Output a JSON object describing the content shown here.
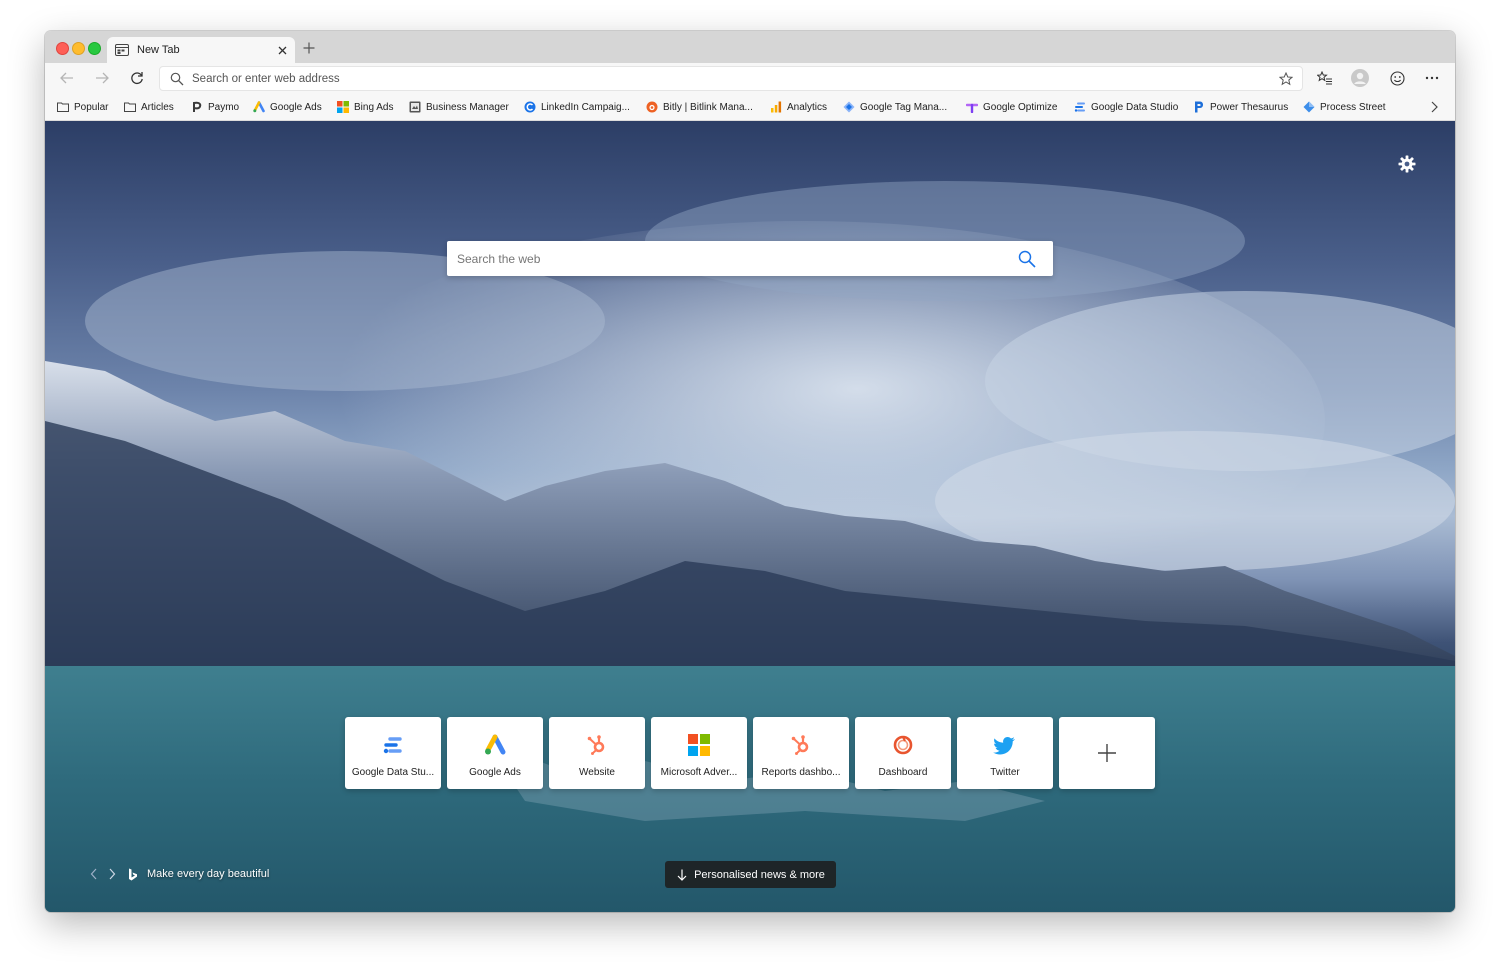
{
  "window": {
    "tab": {
      "title": "New Tab"
    }
  },
  "toolbar": {
    "address_placeholder": "Search or enter web address"
  },
  "bookmarks": [
    {
      "label": "Popular",
      "icon": "folder-icon"
    },
    {
      "label": "Articles",
      "icon": "folder-icon"
    },
    {
      "label": "Paymo",
      "icon": "paymo-icon"
    },
    {
      "label": "Google Ads",
      "icon": "google-ads-icon"
    },
    {
      "label": "Bing Ads",
      "icon": "microsoft-icon"
    },
    {
      "label": "Business Manager",
      "icon": "business-manager-icon"
    },
    {
      "label": "LinkedIn Campaig...",
      "icon": "linkedin-campaign-icon"
    },
    {
      "label": "Bitly | Bitlink Mana...",
      "icon": "bitly-icon"
    },
    {
      "label": "Analytics",
      "icon": "analytics-icon"
    },
    {
      "label": "Google Tag Mana...",
      "icon": "tag-manager-icon"
    },
    {
      "label": "Google Optimize",
      "icon": "google-optimize-icon"
    },
    {
      "label": "Google Data Studio",
      "icon": "data-studio-icon"
    },
    {
      "label": "Power Thesaurus",
      "icon": "power-thesaurus-icon"
    },
    {
      "label": "Process Street",
      "icon": "process-street-icon"
    }
  ],
  "newtab": {
    "search_placeholder": "Search the web",
    "tiles": [
      {
        "label": "Google Data Stu...",
        "icon": "data-studio-icon"
      },
      {
        "label": "Google Ads",
        "icon": "google-ads-icon"
      },
      {
        "label": "Website",
        "icon": "hubspot-icon"
      },
      {
        "label": "Microsoft Adver...",
        "icon": "microsoft-icon"
      },
      {
        "label": "Reports dashbo...",
        "icon": "hubspot-icon"
      },
      {
        "label": "Dashboard",
        "icon": "dashboard-icon"
      },
      {
        "label": "Twitter",
        "icon": "twitter-icon"
      }
    ],
    "tagline": "Make every day beautiful",
    "news_button": "Personalised news & more"
  },
  "colors": {
    "accent_blue": "#1a73e8",
    "hubspot_orange": "#ff7a59",
    "twitter_blue": "#1da1f2"
  }
}
